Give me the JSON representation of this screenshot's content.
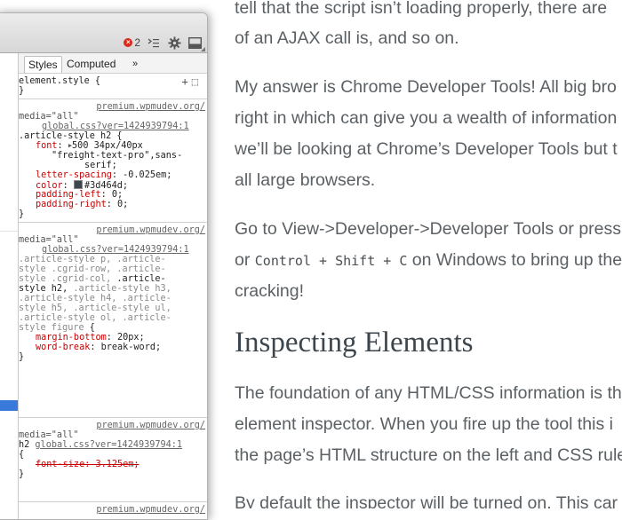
{
  "article": {
    "lines": [
      {
        "text": "tell that the script isn’t loading properly, there are"
      },
      {
        "text": "of an AJAX call is, and so on."
      },
      {
        "text": "My answer is Chrome Developer Tools! All big bro"
      },
      {
        "text": "right in which can give you a wealth of information"
      },
      {
        "text": "we’ll be looking at Chrome’s Developer Tools but t"
      },
      {
        "text": "all large browsers."
      },
      {
        "text": "Go to View->Developer->Developer Tools or press"
      },
      {
        "before": "or ",
        "code": "Control + Shift + C",
        "after": " on Windows to bring up the"
      },
      {
        "text": "cracking!"
      },
      {
        "text": "The foundation of any HTML/CSS information is th"
      },
      {
        "text": "element inspector. When you fire up the tool this i"
      },
      {
        "text": "the page’s HTML structure on the left and CSS rule"
      },
      {
        "text": "By default the inspector will be turned on. This car"
      }
    ],
    "heading": "Inspecting Elements"
  },
  "devtools": {
    "toolbar": {
      "error_count": "2",
      "icons": [
        "error-icon",
        "console-icon",
        "gear-icon",
        "dock-icon"
      ]
    },
    "tabs": {
      "styles": "Styles",
      "computed": "Computed",
      "more": "»"
    },
    "element_style": {
      "selector": "element.style {",
      "close": "}"
    },
    "rules": [
      {
        "source": "premium.wpmudev.org/",
        "media": "media=\"all\"",
        "file": "global.css?ver=1424939794:1",
        "selector": ".article-style h2 {",
        "decls": {
          "font_name": "font",
          "font_value": "500 34px/40px",
          "font_value2": "\"freight-text-pro\",sans-",
          "font_value3": "serif;",
          "ls_name": "letter-spacing",
          "ls_value": "-0.025em;",
          "color_name": "color",
          "color_value": "#3d464d;",
          "pl_name": "padding-left",
          "pl_value": "0;",
          "pr_name": "padding-right",
          "pr_value": "0;"
        },
        "close": "}"
      },
      {
        "source": "premium.wpmudev.org/",
        "media": "media=\"all\"",
        "file": "global.css?ver=1424939794:1",
        "sel_lines": [
          ".article-style p, .article-",
          "style .cgrid-row, .article-",
          "style .cgrid-col,",
          ".article-",
          "style h2,",
          ".article-style h3,",
          ".article-style h4, .article-",
          "style h5, .article-style ul,",
          ".article-style ol, .article-",
          "style figure",
          "{"
        ],
        "mb_name": "margin-bottom",
        "mb_value": "20px;",
        "wb_name": "word-break",
        "wb_value": "break-word;",
        "close": "}"
      },
      {
        "source": "premium.wpmudev.org/",
        "media": "media=\"all\"",
        "tag": "h2",
        "file": "global.css?ver=1424939794:1",
        "open": "{",
        "fs_decl": "font-size: 3.125em;",
        "close": "}"
      },
      {
        "source": "premium.wpmudev.org/"
      }
    ]
  }
}
